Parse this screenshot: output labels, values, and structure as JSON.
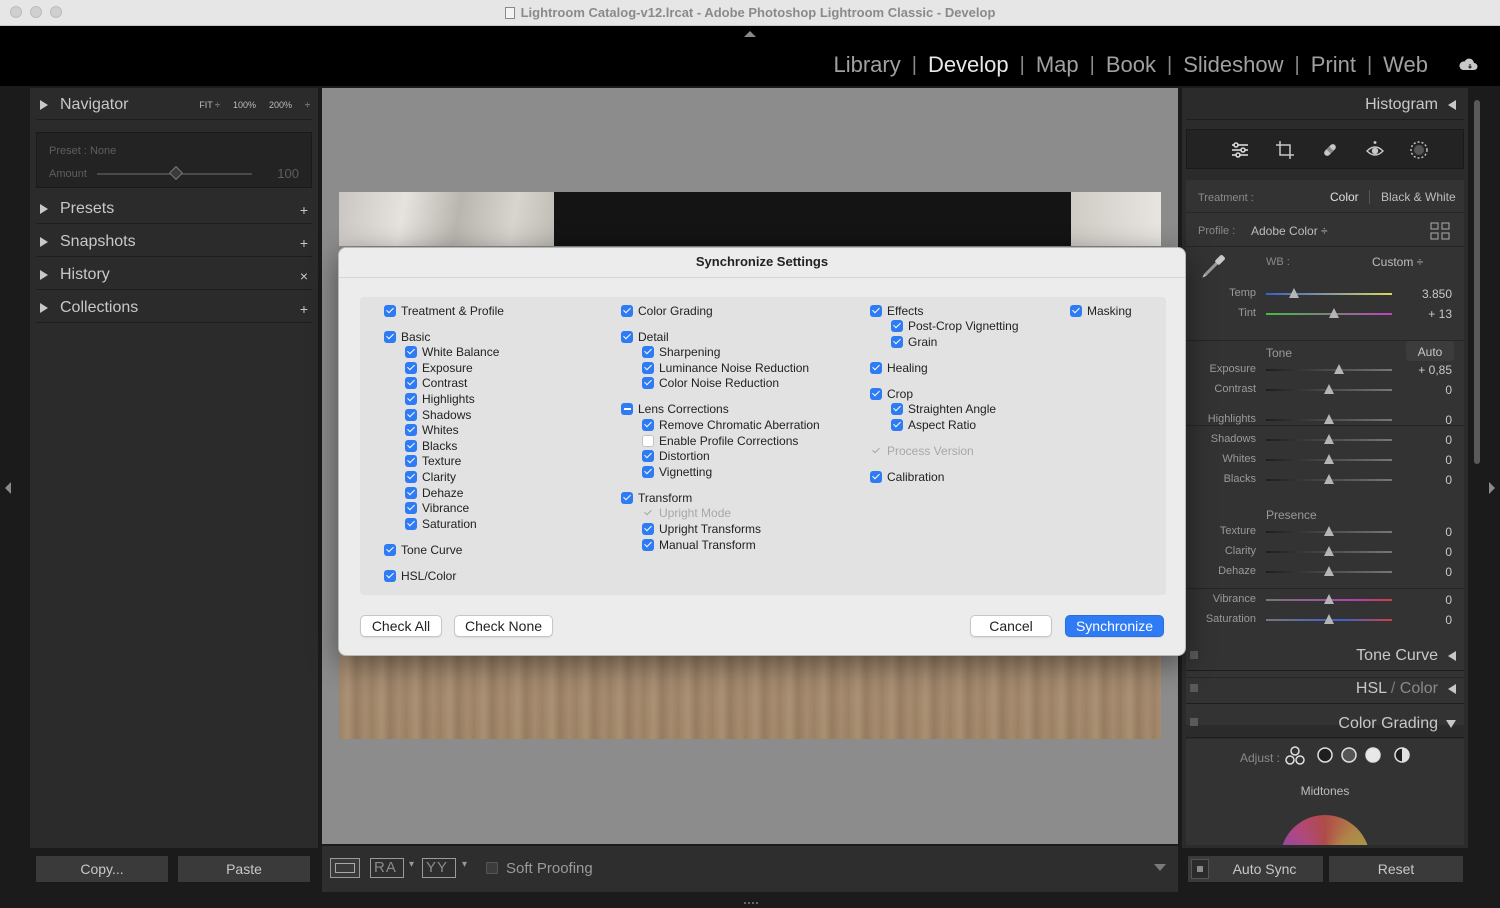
{
  "window": {
    "title": "Lightroom Catalog-v12.lrcat - Adobe Photoshop Lightroom Classic - Develop"
  },
  "modules": [
    {
      "label": "Library",
      "active": false
    },
    {
      "label": "Develop",
      "active": true
    },
    {
      "label": "Map",
      "active": false
    },
    {
      "label": "Book",
      "active": false
    },
    {
      "label": "Slideshow",
      "active": false
    },
    {
      "label": "Print",
      "active": false
    },
    {
      "label": "Web",
      "active": false
    }
  ],
  "module_separator": "|",
  "left_panel": {
    "navigator": {
      "title": "Navigator",
      "zoom": [
        "FIT ÷",
        "100%",
        "200%",
        "÷"
      ]
    },
    "preset_box": {
      "preset": "Preset : None",
      "amount_label": "Amount",
      "amount_value": "100"
    },
    "sections": [
      {
        "title": "Presets",
        "action": "+"
      },
      {
        "title": "Snapshots",
        "action": "+"
      },
      {
        "title": "History",
        "action": "×"
      },
      {
        "title": "Collections",
        "action": "+"
      }
    ],
    "copy_label": "Copy...",
    "paste_label": "Paste"
  },
  "toolbar": {
    "soft_proofing": "Soft Proofing",
    "view_a": "RA",
    "view_b": "YY"
  },
  "right_panel": {
    "histogram": "Histogram",
    "treatment_label": "Treatment :",
    "treatment_color": "Color",
    "treatment_bw": "Black & White",
    "profile_label": "Profile :",
    "profile_value": "Adobe Color ÷",
    "wb_label": "WB :",
    "wb_value": "Custom ÷",
    "tone_label": "Tone",
    "auto_label": "Auto",
    "presence_label": "Presence",
    "sliders": [
      {
        "label": "Temp",
        "value": "3.850",
        "pos": 0.22,
        "gradient": "temp"
      },
      {
        "label": "Tint",
        "value": "+ 13",
        "pos": 0.54,
        "gradient": "tint"
      },
      {
        "label": "Exposure",
        "value": "+ 0,85",
        "pos": 0.58,
        "gradient": "gray"
      },
      {
        "label": "Contrast",
        "value": "0",
        "pos": 0.5,
        "gradient": "gray"
      },
      {
        "label": "Highlights",
        "value": "0",
        "pos": 0.5,
        "gradient": "gray"
      },
      {
        "label": "Shadows",
        "value": "0",
        "pos": 0.5,
        "gradient": "gray"
      },
      {
        "label": "Whites",
        "value": "0",
        "pos": 0.5,
        "gradient": "gray"
      },
      {
        "label": "Blacks",
        "value": "0",
        "pos": 0.5,
        "gradient": "gray"
      },
      {
        "label": "Texture",
        "value": "0",
        "pos": 0.5,
        "gradient": "gray"
      },
      {
        "label": "Clarity",
        "value": "0",
        "pos": 0.5,
        "gradient": "gray"
      },
      {
        "label": "Dehaze",
        "value": "0",
        "pos": 0.5,
        "gradient": "gray"
      },
      {
        "label": "Vibrance",
        "value": "0",
        "pos": 0.5,
        "gradient": "vib"
      },
      {
        "label": "Saturation",
        "value": "0",
        "pos": 0.5,
        "gradient": "sat"
      }
    ],
    "tone_curve": "Tone Curve",
    "hsl_a": "HSL",
    "hsl_sep": " / ",
    "hsl_b": "Color",
    "color_grading": "Color Grading",
    "adjust_label": "Adjust :",
    "midtones_label": "Midtones",
    "auto_sync_label": "Auto Sync",
    "reset_label": "Reset"
  },
  "dialog": {
    "title": "Synchronize Settings",
    "columns": [
      [
        {
          "label": "Treatment & Profile",
          "state": "on",
          "level": 0,
          "gap": 0
        },
        {
          "label": "Basic",
          "state": "on",
          "level": 0,
          "gap": 1
        },
        {
          "label": "White Balance",
          "state": "on",
          "level": 1,
          "gap": 0
        },
        {
          "label": "Exposure",
          "state": "on",
          "level": 1,
          "gap": 0
        },
        {
          "label": "Contrast",
          "state": "on",
          "level": 1,
          "gap": 0
        },
        {
          "label": "Highlights",
          "state": "on",
          "level": 1,
          "gap": 0
        },
        {
          "label": "Shadows",
          "state": "on",
          "level": 1,
          "gap": 0
        },
        {
          "label": "Whites",
          "state": "on",
          "level": 1,
          "gap": 0
        },
        {
          "label": "Blacks",
          "state": "on",
          "level": 1,
          "gap": 0
        },
        {
          "label": "Texture",
          "state": "on",
          "level": 1,
          "gap": 0
        },
        {
          "label": "Clarity",
          "state": "on",
          "level": 1,
          "gap": 0
        },
        {
          "label": "Dehaze",
          "state": "on",
          "level": 1,
          "gap": 0
        },
        {
          "label": "Vibrance",
          "state": "on",
          "level": 1,
          "gap": 0
        },
        {
          "label": "Saturation",
          "state": "on",
          "level": 1,
          "gap": 0
        },
        {
          "label": "Tone Curve",
          "state": "on",
          "level": 0,
          "gap": 1
        },
        {
          "label": "HSL/Color",
          "state": "on",
          "level": 0,
          "gap": 1
        }
      ],
      [
        {
          "label": "Color Grading",
          "state": "on",
          "level": 0,
          "gap": 0
        },
        {
          "label": "Detail",
          "state": "on",
          "level": 0,
          "gap": 1
        },
        {
          "label": "Sharpening",
          "state": "on",
          "level": 1,
          "gap": 0
        },
        {
          "label": "Luminance Noise Reduction",
          "state": "on",
          "level": 1,
          "gap": 0
        },
        {
          "label": "Color Noise Reduction",
          "state": "on",
          "level": 1,
          "gap": 0
        },
        {
          "label": "Lens Corrections",
          "state": "mixed",
          "level": 0,
          "gap": 1
        },
        {
          "label": "Remove Chromatic Aberration",
          "state": "on",
          "level": 1,
          "gap": 0
        },
        {
          "label": "Enable Profile Corrections",
          "state": "off",
          "level": 1,
          "gap": 0
        },
        {
          "label": "Distortion",
          "state": "on",
          "level": 1,
          "gap": 0
        },
        {
          "label": "Vignetting",
          "state": "on",
          "level": 1,
          "gap": 0
        },
        {
          "label": "Transform",
          "state": "on",
          "level": 0,
          "gap": 1
        },
        {
          "label": "Upright Mode",
          "state": "disabled",
          "level": 1,
          "gap": 0
        },
        {
          "label": "Upright Transforms",
          "state": "on",
          "level": 1,
          "gap": 0
        },
        {
          "label": "Manual Transform",
          "state": "on",
          "level": 1,
          "gap": 0
        }
      ],
      [
        {
          "label": "Effects",
          "state": "on",
          "level": 0,
          "gap": 0
        },
        {
          "label": "Post-Crop Vignetting",
          "state": "on",
          "level": 1,
          "gap": 0
        },
        {
          "label": "Grain",
          "state": "on",
          "level": 1,
          "gap": 0
        },
        {
          "label": "Healing",
          "state": "on",
          "level": 0,
          "gap": 1
        },
        {
          "label": "Crop",
          "state": "on",
          "level": 0,
          "gap": 1
        },
        {
          "label": "Straighten Angle",
          "state": "on",
          "level": 1,
          "gap": 0
        },
        {
          "label": "Aspect Ratio",
          "state": "on",
          "level": 1,
          "gap": 0
        },
        {
          "label": "Process Version",
          "state": "disabled",
          "level": 0,
          "gap": 1
        },
        {
          "label": "Calibration",
          "state": "on",
          "level": 0,
          "gap": 1
        }
      ],
      [
        {
          "label": "Masking",
          "state": "on",
          "level": 0,
          "gap": 0
        }
      ]
    ],
    "check_all": "Check All",
    "check_none": "Check None",
    "cancel": "Cancel",
    "synchronize": "Synchronize"
  },
  "colors": {
    "accent": "#2f7bf5",
    "panel": "#2b2b2b",
    "dialog_bg": "#ececec"
  }
}
